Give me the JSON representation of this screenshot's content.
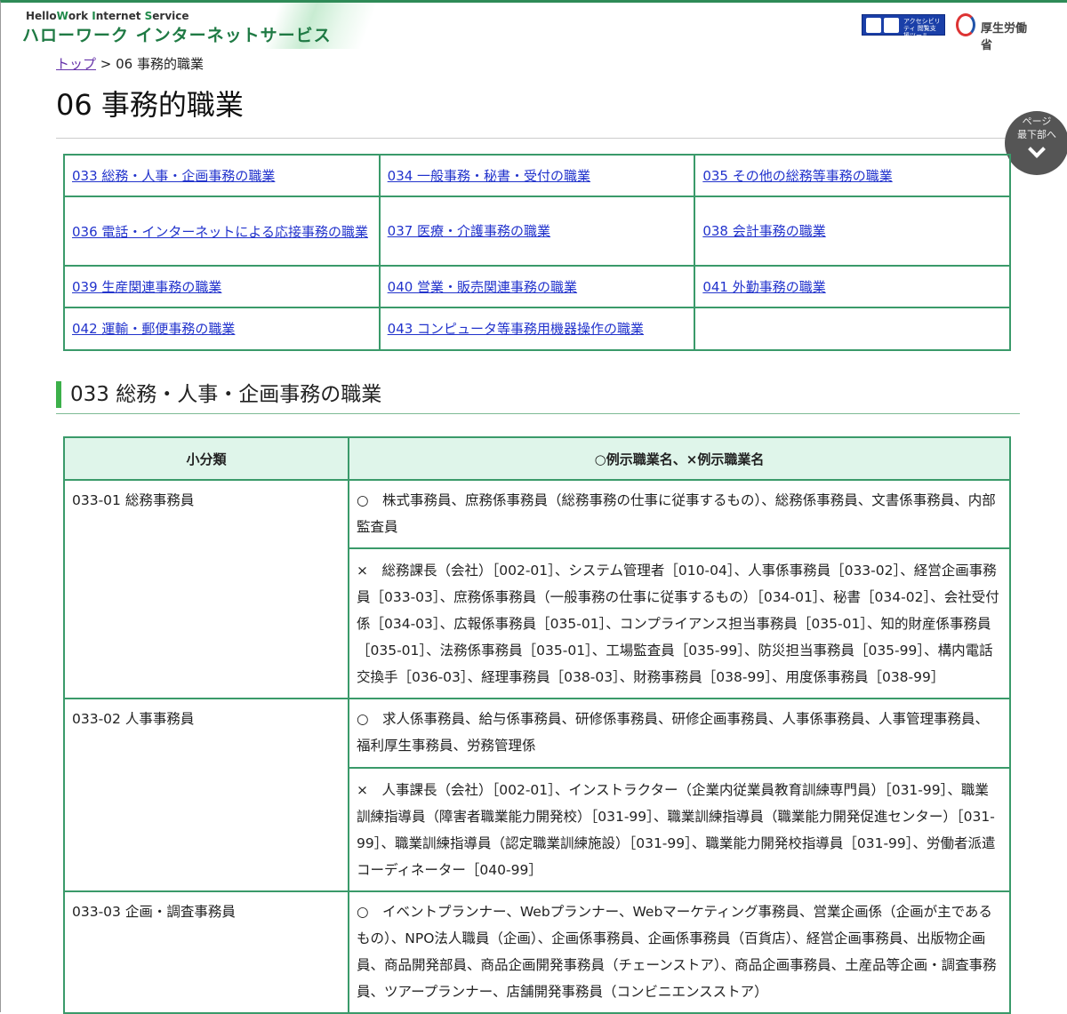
{
  "header": {
    "brand_en_parts": [
      "Hello",
      "W",
      "ork ",
      "I",
      "nternet ",
      "S",
      "ervice"
    ],
    "brand_ja": "ハローワーク インターネットサービス",
    "accessibility_label": "アクセシビリティ 閲覧支援ツール",
    "mhlw_label": "厚生労働省"
  },
  "breadcrumb": {
    "top": "トップ",
    "sep": " > ",
    "current": "06 事務的職業"
  },
  "page_title": "06 事務的職業",
  "page_bottom": {
    "line1": "ページ",
    "line2": "最下部へ"
  },
  "links": [
    [
      "033 総務・人事・企画事務の職業",
      "034 一般事務・秘書・受付の職業",
      "035 その他の総務等事務の職業"
    ],
    [
      "036 電話・インターネットによる応接事務の職業",
      "037 医療・介護事務の職業",
      "038 会計事務の職業"
    ],
    [
      "039 生産関連事務の職業",
      "040 営業・販売関連事務の職業",
      "041 外勤事務の職業"
    ],
    [
      "042 運輸・郵便事務の職業",
      "043 コンピュータ等事務用機器操作の職業",
      ""
    ]
  ],
  "section_title": "033 総務・人事・企画事務の職業",
  "table": {
    "headers": [
      "小分類",
      "○例示職業名、×例示職業名"
    ],
    "rows": [
      {
        "code": "033-01 総務事務員",
        "yes": "○　株式事務員、庶務係事務員（総務事務の仕事に従事するもの）、総務係事務員、文書係事務員、内部監査員",
        "no": "×　総務課長（会社）［002-01］、システム管理者［010-04］、人事係事務員［033-02］、経営企画事務員［033-03］、庶務係事務員（一般事務の仕事に従事するもの）［034-01］、秘書［034-02］、会社受付係［034-03］、広報係事務員［035-01］、コンプライアンス担当事務員［035-01］、知的財産係事務員［035-01］、法務係事務員［035-01］、工場監査員［035-99］、防災担当事務員［035-99］、構内電話交換手［036-03］、経理事務員［038-03］、財務事務員［038-99］、用度係事務員［038-99］"
      },
      {
        "code": "033-02 人事事務員",
        "yes": "○　求人係事務員、給与係事務員、研修係事務員、研修企画事務員、人事係事務員、人事管理事務員、福利厚生事務員、労務管理係",
        "no": "×　人事課長（会社）［002-01］、インストラクター（企業内従業員教育訓練専門員）［031-99］、職業訓練指導員（障害者職業能力開発校）［031-99］、職業訓練指導員（職業能力開発促進センター）［031-99］、職業訓練指導員（認定職業訓練施設）［031-99］、職業能力開発校指導員［031-99］、労働者派遣コーディネーター［040-99］"
      },
      {
        "code": "033-03 企画・調査事務員",
        "yes": "○　イベントプランナー、Webプランナー、Webマーケティング事務員、営業企画係（企画が主であるもの）、NPO法人職員（企画）、企画係事務員、企画係事務員（百貨店）、経営企画事務員、出版物企画員、商品開発部員、商品企画開発事務員（チェーンストア）、商品企画事務員、土産品等企画・調査事務員、ツアープランナー、店舗開発事務員（コンビニエンスストア）"
      }
    ]
  }
}
